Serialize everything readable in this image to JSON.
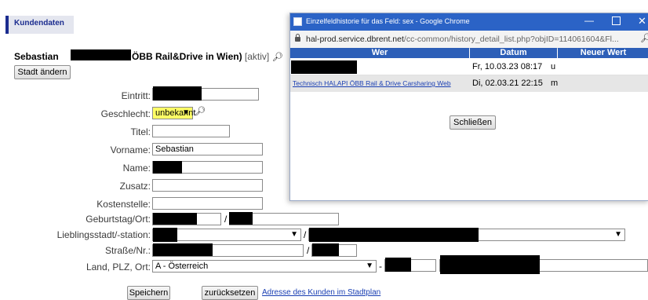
{
  "app": {
    "section_title": "Kundendaten",
    "customer_first": "Sebastian",
    "customer_suffix": "ÖBB Rail&Drive in Wien)",
    "status_link": "[aktiv]",
    "change_city_button": "Stadt ändern"
  },
  "form": {
    "eintritt_label": "Eintritt:",
    "geschlecht_label": "Geschlecht:",
    "geschlecht_value": "unbekannt",
    "titel_label": "Titel:",
    "vorname_label": "Vorname:",
    "vorname_value": "Sebastian",
    "name_label": "Name:",
    "zusatz_label": "Zusatz:",
    "kostenstelle_label": "Kostenstelle:",
    "geburtstag_label": "Geburtstag/Ort:",
    "lieblingsstadt_label": "Lieblingsstadt/-station:",
    "strasse_label": "Straße/Nr.:",
    "land_label": "Land, PLZ, Ort:",
    "land_value": "A - Österreich",
    "slash": "/",
    "dash": "-"
  },
  "actions": {
    "save_button": "Speichern",
    "reset_button": "zurücksetzen",
    "map_link": "Adresse des Kunden im Stadtplan"
  },
  "popup": {
    "window_title": "Einzelfeldhistorie für das Feld: sex - Google Chrome",
    "url_host": "hal-prod.service.dbrent.net",
    "url_path": "/cc-common/history_detail_list.php?objID=114061604&Fl...",
    "columns": [
      "Wer",
      "Datum",
      "Neuer Wert"
    ],
    "rows": [
      {
        "wer": "",
        "datum": "Fr, 10.03.23 08:17",
        "wert": "u"
      },
      {
        "wer": "Technisch HALAPI ÖBB Rail & Drive Carsharing Web",
        "datum": "Di, 02.03.21 22:15",
        "wert": "m"
      }
    ],
    "close_button": "Schließen"
  },
  "colors": {
    "accent_blue": "#2b63c6",
    "header_bar": "#2d5fb8",
    "highlight_select": "#ffff66"
  },
  "icons": [
    "search-icon",
    "lock-icon",
    "window-minimize-icon",
    "window-maximize-icon",
    "window-close-icon",
    "chevron-down-icon"
  ]
}
